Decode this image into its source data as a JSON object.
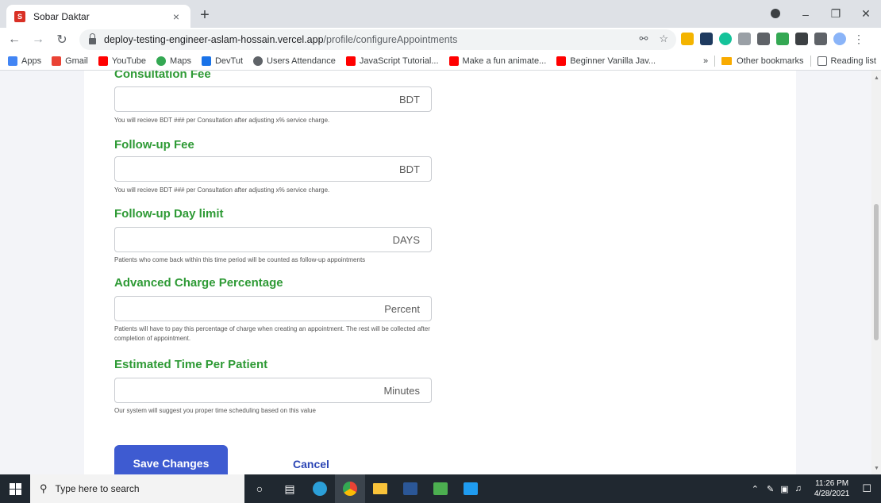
{
  "browser": {
    "tab_title": "Sobar Daktar",
    "tab_close": "×",
    "new_tab": "+",
    "url_host": "deploy-testing-engineer-aslam-hossain.vercel.app",
    "url_path": "/profile/configureAppointments",
    "bookmarks": [
      {
        "label": "Apps",
        "icon": "apps-grid-icon",
        "color": "#4285f4"
      },
      {
        "label": "Gmail",
        "icon": "gmail-icon",
        "color": "#ea4335"
      },
      {
        "label": "YouTube",
        "icon": "youtube-icon",
        "color": "#ff0000"
      },
      {
        "label": "Maps",
        "icon": "maps-pin-icon",
        "color": "#34a853"
      },
      {
        "label": "DevTut",
        "icon": "devtut-icon",
        "color": "#1a73e8"
      },
      {
        "label": "Users Attendance",
        "icon": "globe-icon",
        "color": "#5f6368"
      },
      {
        "label": "JavaScript Tutorial...",
        "icon": "youtube-icon",
        "color": "#ff0000"
      },
      {
        "label": "Make a fun animate...",
        "icon": "youtube-icon",
        "color": "#ff0000"
      },
      {
        "label": "Beginner Vanilla Jav...",
        "icon": "youtube-icon",
        "color": "#ff0000"
      }
    ],
    "bookmarks_overflow": "»",
    "other_bookmarks": "Other bookmarks",
    "reading_list": "Reading list"
  },
  "form": {
    "section_heading_partial": "Consultation Fee",
    "fields": [
      {
        "label": "Consultation Fee",
        "suffix": "BDT",
        "help": "You will recieve BDT ### per Consultation after adjusting x% service charge."
      },
      {
        "label": "Follow-up Fee",
        "suffix": "BDT",
        "help": "You will recieve BDT ### per Consultation after adjusting x% service charge."
      },
      {
        "label": "Follow-up Day limit",
        "suffix": "DAYS",
        "help": "Patients who come back within this time period will be counted as follow-up appointments"
      },
      {
        "label": "Advanced Charge Percentage",
        "suffix": "Percent",
        "help": "Patients will have to pay this percentage of charge when creating an appointment. The rest will be collected after completion of appointment."
      },
      {
        "label": "Estimated Time Per Patient",
        "suffix": "Minutes",
        "help": "Our system will suggest you proper time scheduling based on this value"
      }
    ],
    "save_label": "Save Changes",
    "cancel_label": "Cancel"
  },
  "taskbar": {
    "search_placeholder": "Type here to search",
    "time": "11:26 PM",
    "date": "4/28/2021"
  },
  "colors": {
    "label_green": "#2e9a35",
    "save_blue": "#3e5bd1",
    "cancel_blue": "#2c46b5"
  }
}
